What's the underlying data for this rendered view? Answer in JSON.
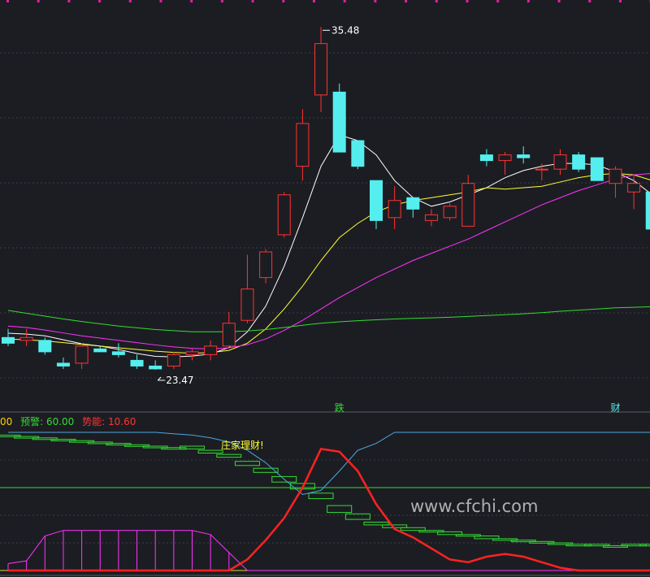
{
  "chart_data": {
    "type": "candlestick",
    "price_range": [
      22.9,
      36.2
    ],
    "annotations": {
      "high_label": "35.48",
      "low_label": "23.47",
      "marker_fall": "跌",
      "marker_wealth": "财"
    },
    "candles": [
      {
        "o": 24.6,
        "h": 24.9,
        "l": 24.3,
        "c": 24.4
      },
      {
        "o": 24.5,
        "h": 24.9,
        "l": 24.3,
        "c": 24.6
      },
      {
        "o": 24.5,
        "h": 24.6,
        "l": 24.0,
        "c": 24.1
      },
      {
        "o": 23.7,
        "h": 23.9,
        "l": 23.5,
        "c": 23.6
      },
      {
        "o": 23.7,
        "h": 24.4,
        "l": 23.5,
        "c": 24.3
      },
      {
        "o": 24.2,
        "h": 24.3,
        "l": 24.1,
        "c": 24.1
      },
      {
        "o": 24.1,
        "h": 24.4,
        "l": 23.9,
        "c": 24.0
      },
      {
        "o": 23.8,
        "h": 24.0,
        "l": 23.5,
        "c": 23.6
      },
      {
        "o": 23.6,
        "h": 23.8,
        "l": 23.47,
        "c": 23.5
      },
      {
        "o": 23.6,
        "h": 24.1,
        "l": 23.5,
        "c": 24.0
      },
      {
        "o": 24.0,
        "h": 24.2,
        "l": 23.8,
        "c": 24.1
      },
      {
        "o": 24.0,
        "h": 24.5,
        "l": 23.8,
        "c": 24.3
      },
      {
        "o": 24.3,
        "h": 25.5,
        "l": 24.3,
        "c": 25.1
      },
      {
        "o": 25.2,
        "h": 27.5,
        "l": 25.1,
        "c": 26.3
      },
      {
        "o": 26.7,
        "h": 27.7,
        "l": 26.5,
        "c": 27.6
      },
      {
        "o": 28.2,
        "h": 29.7,
        "l": 28.1,
        "c": 29.6
      },
      {
        "o": 30.6,
        "h": 32.6,
        "l": 30.1,
        "c": 32.1
      },
      {
        "o": 33.1,
        "h": 35.48,
        "l": 32.5,
        "c": 34.9
      },
      {
        "o": 33.2,
        "h": 33.5,
        "l": 31.1,
        "c": 31.1
      },
      {
        "o": 31.5,
        "h": 31.5,
        "l": 30.5,
        "c": 30.6
      },
      {
        "o": 30.1,
        "h": 30.1,
        "l": 28.4,
        "c": 28.7
      },
      {
        "o": 28.8,
        "h": 29.9,
        "l": 28.4,
        "c": 29.4
      },
      {
        "o": 29.5,
        "h": 29.5,
        "l": 28.8,
        "c": 29.1
      },
      {
        "o": 28.7,
        "h": 29.1,
        "l": 28.5,
        "c": 28.9
      },
      {
        "o": 28.8,
        "h": 29.3,
        "l": 28.7,
        "c": 29.2
      },
      {
        "o": 28.5,
        "h": 30.3,
        "l": 28.5,
        "c": 30.0
      },
      {
        "o": 31.0,
        "h": 31.2,
        "l": 30.6,
        "c": 30.8
      },
      {
        "o": 30.8,
        "h": 31.1,
        "l": 30.3,
        "c": 31.0
      },
      {
        "o": 31.0,
        "h": 31.3,
        "l": 30.7,
        "c": 30.9
      },
      {
        "o": 30.5,
        "h": 30.7,
        "l": 30.1,
        "c": 30.5
      },
      {
        "o": 30.5,
        "h": 31.2,
        "l": 30.3,
        "c": 31.0
      },
      {
        "o": 31.0,
        "h": 31.1,
        "l": 30.4,
        "c": 30.5
      },
      {
        "o": 30.9,
        "h": 30.9,
        "l": 30.1,
        "c": 30.1
      },
      {
        "o": 30.0,
        "h": 30.6,
        "l": 29.5,
        "c": 30.5
      },
      {
        "o": 29.7,
        "h": 30.3,
        "l": 29.1,
        "c": 30.0
      },
      {
        "o": 29.7,
        "h": 29.8,
        "l": 28.4,
        "c": 28.4
      },
      {
        "o": 29.0,
        "h": 29.2,
        "l": 28.4,
        "c": 28.4
      }
    ],
    "ma_series": [
      {
        "color": "#ffffff",
        "values": [
          24.75,
          24.72,
          24.66,
          24.52,
          24.38,
          24.3,
          24.18,
          24.04,
          23.94,
          23.92,
          23.95,
          24.02,
          24.25,
          24.8,
          25.7,
          27.1,
          28.8,
          30.6,
          31.7,
          31.5,
          31.0,
          30.1,
          29.5,
          29.2,
          29.35,
          29.6,
          29.85,
          30.2,
          30.45,
          30.6,
          30.7,
          30.7,
          30.65,
          30.4,
          30.1,
          29.6,
          29.1
        ]
      },
      {
        "color": "#ffff33",
        "values": [
          24.55,
          24.52,
          24.48,
          24.42,
          24.36,
          24.3,
          24.24,
          24.18,
          24.12,
          24.08,
          24.05,
          24.07,
          24.15,
          24.4,
          24.9,
          25.6,
          26.4,
          27.3,
          28.1,
          28.6,
          29.0,
          29.25,
          29.4,
          29.5,
          29.6,
          29.7,
          29.85,
          29.8,
          29.85,
          29.9,
          30.05,
          30.2,
          30.3,
          30.35,
          30.3,
          30.1,
          29.9
        ]
      },
      {
        "color": "#ff33ff",
        "values": [
          25.0,
          24.95,
          24.86,
          24.76,
          24.66,
          24.58,
          24.5,
          24.42,
          24.34,
          24.27,
          24.22,
          24.2,
          24.24,
          24.35,
          24.55,
          24.85,
          25.2,
          25.6,
          26.0,
          26.35,
          26.7,
          27.0,
          27.3,
          27.55,
          27.8,
          28.05,
          28.35,
          28.65,
          28.95,
          29.25,
          29.5,
          29.75,
          29.95,
          30.15,
          30.3,
          30.35,
          30.3
        ]
      },
      {
        "color": "#33dd33",
        "values": [
          25.55,
          25.45,
          25.35,
          25.25,
          25.16,
          25.08,
          25.0,
          24.94,
          24.88,
          24.84,
          24.8,
          24.8,
          24.8,
          24.83,
          24.88,
          24.95,
          25.03,
          25.1,
          25.15,
          25.19,
          25.22,
          25.25,
          25.27,
          25.29,
          25.31,
          25.34,
          25.37,
          25.4,
          25.43,
          25.47,
          25.52,
          25.56,
          25.6,
          25.64,
          25.66,
          25.68,
          25.69
        ]
      }
    ],
    "indicator": {
      "legend_prefix": "00",
      "legend_warning": "预警: 60.00",
      "legend_momentum": "势能: 10.60",
      "tag": "庄家理财!",
      "range": [
        0,
        100
      ],
      "threshold": 60,
      "cyan_line": [
        100,
        100,
        100,
        100,
        100,
        100,
        100,
        100,
        100,
        99,
        98,
        96,
        93,
        87,
        78,
        66,
        55,
        58,
        72,
        87,
        92,
        100,
        100,
        100,
        100,
        100,
        100,
        100,
        100,
        100,
        100,
        100,
        100,
        100,
        100,
        100,
        100
      ],
      "red_line": [
        0,
        0,
        0,
        0,
        0,
        0,
        0,
        0,
        0,
        0,
        0,
        0,
        0,
        8,
        22,
        38,
        60,
        88,
        86,
        72,
        48,
        30,
        24,
        16,
        8,
        6,
        10,
        12,
        10,
        6,
        2,
        0,
        0,
        0,
        0,
        0,
        0
      ],
      "magenta_bars": [
        5,
        7,
        25,
        29,
        29,
        29,
        29,
        29,
        29,
        29,
        29,
        26,
        13,
        0,
        0,
        0,
        0,
        0,
        0,
        0,
        0,
        0,
        0,
        0,
        0,
        0,
        0,
        0,
        0,
        0,
        0,
        0,
        0,
        0,
        0,
        0,
        0
      ],
      "green_boxes": [
        [
          98,
          97
        ],
        [
          97,
          96
        ],
        [
          96,
          95
        ],
        [
          95,
          94
        ],
        [
          94,
          93
        ],
        [
          93,
          93
        ],
        [
          92,
          91
        ],
        [
          91,
          90
        ],
        [
          90,
          89
        ],
        [
          89,
          89
        ],
        [
          90,
          88
        ],
        [
          87,
          85
        ],
        [
          84,
          82
        ],
        [
          79,
          76
        ],
        [
          74,
          71
        ],
        [
          68,
          64
        ],
        [
          63,
          59
        ],
        [
          56,
          52
        ],
        [
          47,
          42
        ],
        [
          41,
          37
        ],
        [
          35,
          33
        ],
        [
          33,
          31
        ],
        [
          31,
          29
        ],
        [
          29,
          28
        ],
        [
          28,
          26
        ],
        [
          26,
          25
        ],
        [
          25,
          23
        ],
        [
          23,
          22
        ],
        [
          22,
          21
        ],
        [
          21,
          20
        ],
        [
          20,
          19
        ],
        [
          19,
          19
        ],
        [
          19,
          18
        ],
        [
          18,
          18
        ],
        [
          18,
          19
        ],
        [
          19,
          19
        ],
        [
          19,
          20
        ]
      ]
    }
  },
  "legend": {
    "prefix": "00",
    "warning": "预警: 60.00",
    "momentum": "势能: 10.60"
  },
  "watermark": "www.cfchi.com",
  "colors": {
    "up": "#ff3333",
    "down": "#55eeee",
    "legend_prefix": "#ffd000",
    "legend_warning": "#33dd33",
    "legend_momentum": "#ff3333"
  }
}
